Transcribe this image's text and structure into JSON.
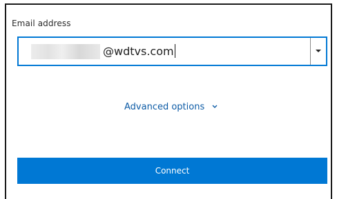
{
  "form": {
    "email_label": "Email address",
    "email_value_visible": "@wdtvs.com",
    "advanced_label": "Advanced options",
    "advanced_icon": "chevron-down-icon",
    "connect_label": "Connect",
    "dropdown_icon": "caret-down-icon",
    "accent_color": "#0078d4",
    "link_color": "#0b5aa5"
  }
}
